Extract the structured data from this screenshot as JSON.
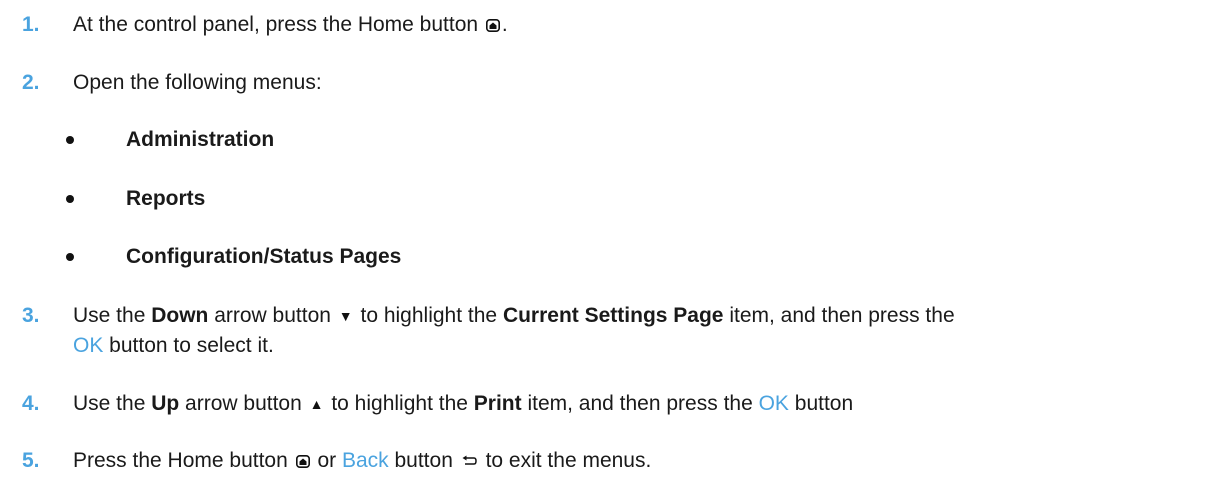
{
  "colors": {
    "step_number": "#4aa3df",
    "link": "#4aa3df",
    "text": "#1a1a1a"
  },
  "icons": {
    "home": "home-icon",
    "down": "down-arrow-icon",
    "up": "up-arrow-icon",
    "back": "back-icon"
  },
  "steps": [
    {
      "number": "1.",
      "t1": "At the control panel, press the Home button",
      "t2": "."
    },
    {
      "number": "2.",
      "t1": "Open the following menus:"
    },
    {
      "number": "3.",
      "t1": "Use the ",
      "b1": "Down",
      "t2": " arrow button",
      "t3": " to highlight the ",
      "b2": "Current Settings Page",
      "t4": " item, and then press the",
      "ok": "OK",
      "t5": " button to select it."
    },
    {
      "number": "4.",
      "t1": "Use the ",
      "b1": "Up",
      "t2": " arrow button",
      "t3": " to highlight the ",
      "b2": "Print",
      "t4": " item, and then press the ",
      "ok": "OK",
      "t5": " button"
    },
    {
      "number": "5.",
      "t1": "Press the Home button",
      "t2": " or ",
      "back": "Back",
      "t3": " button",
      "t4": " to exit the menus."
    }
  ],
  "menus": [
    "Administration",
    "Reports",
    "Configuration/Status Pages"
  ]
}
